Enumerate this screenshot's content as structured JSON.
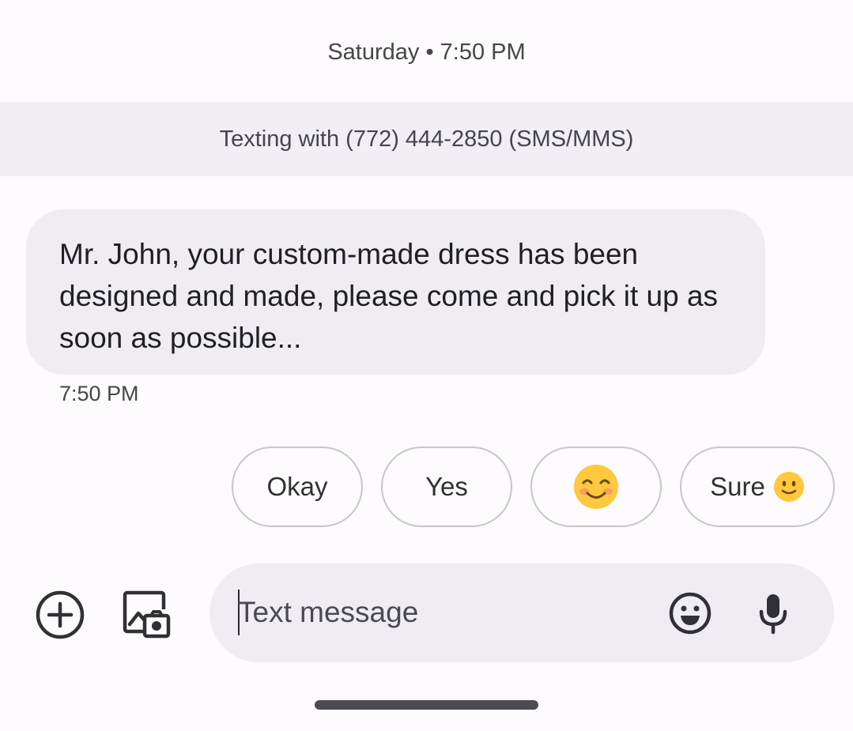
{
  "conversation": {
    "date_header": "Saturday • 7:50 PM",
    "banner_text": "Texting with (772) 444-2850 (SMS/MMS)"
  },
  "message": {
    "text": "Mr. John, your custom-made dress has been designed and made, please come and pick it up as soon as possible...",
    "time": "7:50 PM"
  },
  "smart_replies": {
    "okay": "Okay",
    "yes": "Yes",
    "smile_emoji_icon": "smiling-face-with-blush",
    "sure": "Sure",
    "sure_emoji_icon": "slightly-smiling-face"
  },
  "composer": {
    "placeholder": "Text message",
    "value": "",
    "icons": [
      "add-circle-icon",
      "gallery-camera-icon",
      "emoji-icon",
      "microphone-icon"
    ]
  },
  "colors": {
    "bubble": "#efedf2",
    "banner": "#f1eff4",
    "emoji_yellow": "#ffc83d"
  }
}
